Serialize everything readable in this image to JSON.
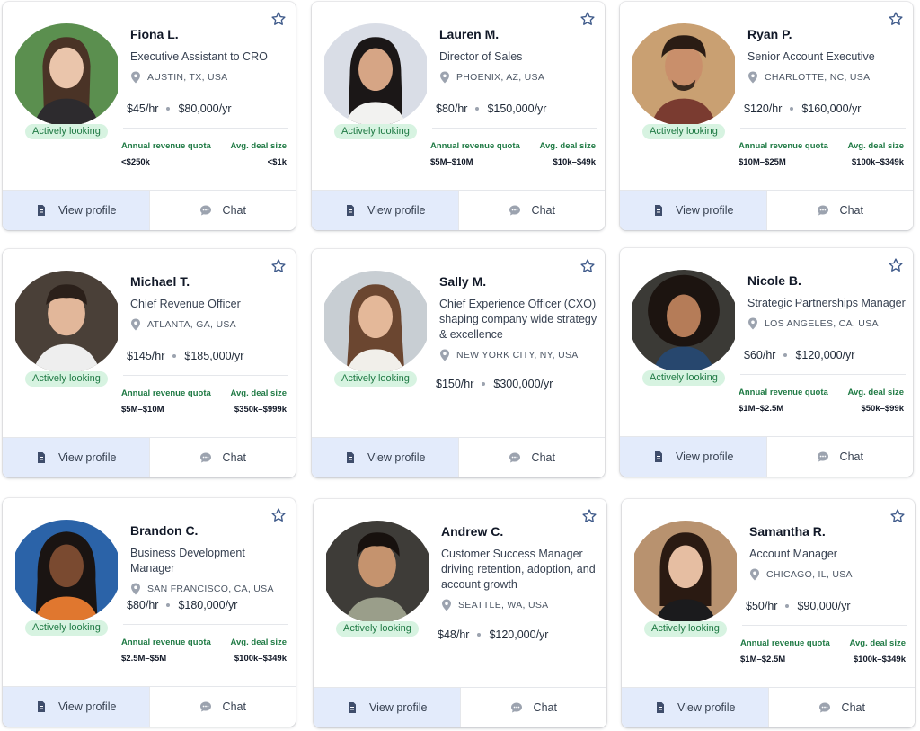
{
  "common": {
    "badge_label": "Actively looking",
    "quota_label": "Annual revenue quota",
    "deal_label": "Avg. deal size",
    "view_profile_label": "View profile",
    "chat_label": "Chat"
  },
  "candidates": [
    {
      "name": "Fiona L.",
      "title": "Executive Assistant to CRO",
      "location": "AUSTIN, TX, USA",
      "rate": "$45/hr",
      "salary": "$80,000/yr",
      "quota": "<$250k",
      "deal": "<$1k"
    },
    {
      "name": "Lauren M.",
      "title": "Director of Sales",
      "location": "PHOENIX, AZ, USA",
      "rate": "$80/hr",
      "salary": "$150,000/yr",
      "quota": "$5M–$10M",
      "deal": "$10k–$49k"
    },
    {
      "name": "Ryan P.",
      "title": "Senior Account Executive",
      "location": "CHARLOTTE, NC, USA",
      "rate": "$120/hr",
      "salary": "$160,000/yr",
      "quota": "$10M–$25M",
      "deal": "$100k–$349k"
    },
    {
      "name": "Michael T.",
      "title": "Chief Revenue Officer",
      "location": "ATLANTA, GA, USA",
      "rate": "$145/hr",
      "salary": "$185,000/yr",
      "quota": "$5M–$10M",
      "deal": "$350k–$999k"
    },
    {
      "name": "Sally M.",
      "title": "Chief Experience Officer (CXO) shaping company wide strategy & excellence",
      "location": "NEW YORK CITY, NY, USA",
      "rate": "$150/hr",
      "salary": "$300,000/yr",
      "quota": "",
      "deal": ""
    },
    {
      "name": "Nicole B.",
      "title": "Strategic Partnerships Manager",
      "location": "LOS ANGELES, CA, USA",
      "rate": "$60/hr",
      "salary": "$120,000/yr",
      "quota": "$1M–$2.5M",
      "deal": "$50k–$99k"
    },
    {
      "name": "Brandon C.",
      "title": "Business Development Manager",
      "location": "SAN FRANCISCO, CA, USA",
      "rate": "$80/hr",
      "salary": "$180,000/yr",
      "quota": "$2.5M–$5M",
      "deal": "$100k–$349k"
    },
    {
      "name": "Andrew C.",
      "title": "Customer Success Manager driving retention, adoption, and account growth",
      "location": "SEATTLE, WA, USA",
      "rate": "$48/hr",
      "salary": "$120,000/yr",
      "quota": "",
      "deal": ""
    },
    {
      "name": "Samantha R.",
      "title": "Account Manager",
      "location": "CHICAGO, IL, USA",
      "rate": "$50/hr",
      "salary": "$90,000/yr",
      "quota": "$1M–$2.5M",
      "deal": "$100k–$349k"
    }
  ],
  "colors": {
    "accent": "#e3ebfb",
    "badge_bg": "#d7f3e1",
    "badge_text": "#1f7a44",
    "star": "#3f5a8a"
  },
  "icons": {
    "star": "star-icon",
    "location": "map-pin-icon",
    "view": "document-icon",
    "chat": "chat-bubble-icon"
  }
}
